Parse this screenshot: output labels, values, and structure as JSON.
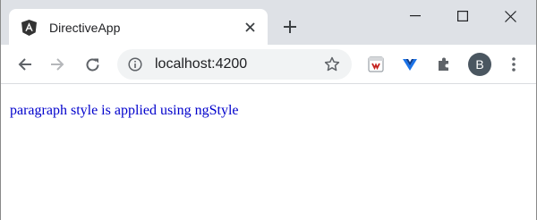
{
  "tab": {
    "title": "DirectiveApp",
    "favicon": "angular-logo-icon"
  },
  "address_bar": {
    "url": "localhost:4200"
  },
  "profile": {
    "initial": "B"
  },
  "page": {
    "paragraph": "paragraph style is applied using ngStyle",
    "paragraph_color": "#0000cc"
  },
  "colors": {
    "tabstrip": "#dee1e6",
    "omnibox": "#f1f3f4",
    "avatar": "#4a5660"
  }
}
